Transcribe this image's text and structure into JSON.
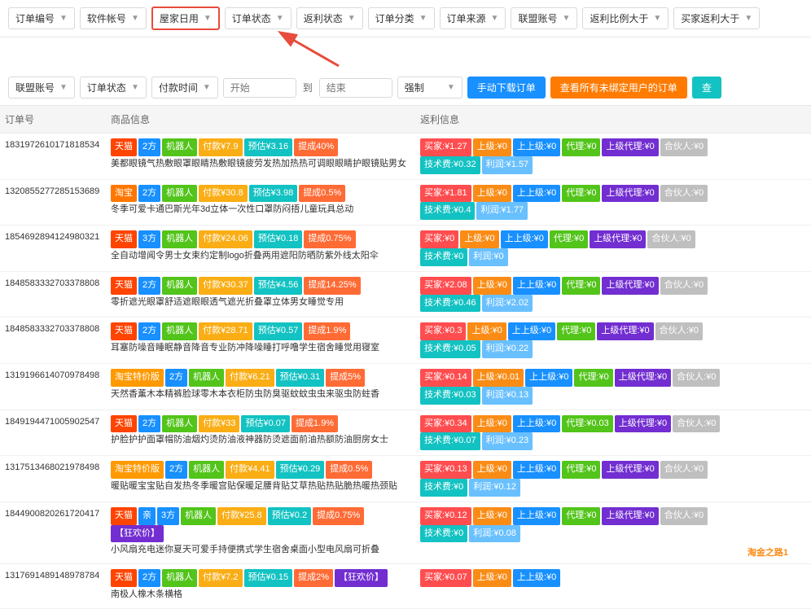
{
  "filters_top": {
    "order_no": {
      "label": "订单编号",
      "placeholder": ""
    },
    "software_account": {
      "label": "软件帐号"
    },
    "category": {
      "label": "屋家日用",
      "highlighted": true
    },
    "order_status": {
      "label": "订单状态"
    },
    "rebate_status": {
      "label": "返利状态"
    },
    "order_type": {
      "label": "订单分类"
    },
    "order_source": {
      "label": "订单来源"
    },
    "union_account": {
      "label": "联盟账号"
    },
    "rebate_ratio": {
      "label": "返利比例大于"
    },
    "buyer_rebate": {
      "label": "买家返利大于"
    }
  },
  "filters_bottom": {
    "union_account": {
      "label": "联盟账号"
    },
    "order_status": {
      "label": "订单状态"
    },
    "pay_time": {
      "label": "付款时间"
    },
    "time_start": "开始",
    "time_to": "到",
    "time_end": "结束",
    "force": {
      "label": "强制"
    },
    "btn_download": "手动下载订单",
    "btn_unbound": "查看所有未绑定用户的订单",
    "btn_search": "查"
  },
  "table": {
    "headers": [
      "订单号",
      "商品信息",
      "返利信息"
    ],
    "rows": [
      {
        "order_no": "1831972610171818534",
        "shop_type": "天猫",
        "num": "2方",
        "robot": "机器人",
        "pay": "付款¥7.9",
        "estimate": "预估¥3.16",
        "grow": "提成40%",
        "goods_desc": "美都眼镜气热敷眼罩眼睛热敷眼镜疲劳发热加热热可调眼眼睛护眼镜贴男女",
        "rebate_buyer": "买家:¥1.27",
        "rebate_up": "上级:¥0",
        "rebate_up2": "上上级:¥0",
        "rebate_agent": "代理:¥0",
        "rebate_up_agent": "上级代理:¥0",
        "rebate_partner": "合伙人:¥0",
        "rebate_tech": "技术费:¥0.32",
        "rebate_profit": "利润:¥1.57"
      },
      {
        "order_no": "1320855277285153689",
        "shop_type": "淘宝",
        "num": "2方",
        "robot": "机器人",
        "pay": "付款¥30.8",
        "estimate": "预估¥3.98",
        "grow": "提成0.5%",
        "goods_desc": "冬季可爱卡通巴斯光年3d立体一次性口罩防闷捂儿童玩具总动",
        "rebate_buyer": "买家:¥1.81",
        "rebate_up": "上级:¥0",
        "rebate_up2": "上上级:¥0",
        "rebate_agent": "代理:¥0",
        "rebate_up_agent": "上级代理:¥0",
        "rebate_partner": "合伙人:¥0",
        "rebate_tech": "技术费:¥0.4",
        "rebate_profit": "利润:¥1.77"
      },
      {
        "order_no": "1854692894124980321",
        "shop_type": "天猫",
        "num": "3方",
        "robot": "机器人",
        "pay": "付款¥24.06",
        "estimate": "预估¥0.18",
        "grow": "提成0.75%",
        "goods_desc": "全自动增闻令男士女束约定制logo折叠两用遮阳防晒防紫外线太阳伞",
        "rebate_buyer": "买家:¥0",
        "rebate_up": "上级:¥0",
        "rebate_up2": "上上级:¥0",
        "rebate_agent": "代理:¥0",
        "rebate_up_agent": "上级代理:¥0",
        "rebate_partner": "合伙人:¥0",
        "rebate_tech": "技术费:¥0",
        "rebate_profit": "利润:¥0"
      },
      {
        "order_no": "1848583332703378808",
        "shop_type": "天猫",
        "num": "2方",
        "robot": "机器人",
        "pay": "付款¥30.37",
        "estimate": "预估¥4.56",
        "grow": "提成14.25%",
        "goods_desc": "零折遮光眼罩舒适遮眼眼透气遮光折叠罩立体男女睡觉专用",
        "rebate_buyer": "买家:¥2.08",
        "rebate_up": "上级:¥0",
        "rebate_up2": "上上级:¥0",
        "rebate_agent": "代理:¥0",
        "rebate_up_agent": "上级代理:¥0",
        "rebate_partner": "合伙人:¥0",
        "rebate_tech": "技术费:¥0.46",
        "rebate_profit": "利润:¥2.02"
      },
      {
        "order_no": "1848583332703378808",
        "shop_type": "天猫",
        "num": "2方",
        "robot": "机器人",
        "pay": "付款¥28.71",
        "estimate": "预估¥0.57",
        "grow": "提成1.9%",
        "goods_desc": "耳塞防噪音睡眠静音降音专业防冲降噪睡打呼噜学生宿舍睡觉用寝室",
        "rebate_buyer": "买家:¥0.3",
        "rebate_up": "上级:¥0",
        "rebate_up2": "上上级:¥0",
        "rebate_agent": "代理:¥0",
        "rebate_up_agent": "上级代理:¥0",
        "rebate_partner": "合伙人:¥0",
        "rebate_tech": "技术费:¥0.05",
        "rebate_profit": "利润:¥0.22"
      },
      {
        "order_no": "1319196614070978498",
        "shop_type": "淘宝特价版",
        "num": "2方",
        "robot": "机器人",
        "pay": "付款¥6.21",
        "estimate": "预估¥0.31",
        "grow": "提成5%",
        "goods_desc": "天然香薰木本精裤脸球零木本衣柜防虫防臭驱蚊蚊虫虫来驱虫防蛀香",
        "rebate_buyer": "买家:¥0.14",
        "rebate_up": "上级:¥0.01",
        "rebate_up2": "上上级:¥0",
        "rebate_agent": "代理:¥0",
        "rebate_up_agent": "上级代理:¥0",
        "rebate_partner": "合伙人:¥0",
        "rebate_tech": "技术费:¥0.03",
        "rebate_profit": "利润:¥0.13"
      },
      {
        "order_no": "1849194471005902547",
        "shop_type": "天猫",
        "num": "2方",
        "robot": "机器人",
        "pay": "付款¥33",
        "estimate": "预估¥0.07",
        "grow": "提成1.9%",
        "goods_desc": "护脸护护面罩帽防油烟灼烫防油液神器防烫遮面前油热额防油厨房女士",
        "rebate_buyer": "买家:¥0.34",
        "rebate_up": "上级:¥0",
        "rebate_up2": "上上级:¥0",
        "rebate_agent": "代理:¥0.03",
        "rebate_up_agent": "上级代理:¥0",
        "rebate_partner": "合伙人:¥0",
        "rebate_tech": "技术费:¥0.07",
        "rebate_profit": "利润:¥0.23"
      },
      {
        "order_no": "1317513468021978498",
        "shop_type": "淘宝特价版",
        "num": "2方",
        "robot": "机器人",
        "pay": "付款¥4.41",
        "estimate": "预估¥0.29",
        "grow": "提成0.5%",
        "goods_desc": "暖贴暖宝宝贴自发热冬季暖宫贴保暖足腰背贴艾草热贴热贴脆热暖热颈贴",
        "rebate_buyer": "买家:¥0.13",
        "rebate_up": "上级:¥0",
        "rebate_up2": "上上级:¥0",
        "rebate_agent": "代理:¥0",
        "rebate_up_agent": "上级代理:¥0",
        "rebate_partner": "合伙人:¥0",
        "rebate_tech": "技术费:¥0",
        "rebate_profit": "利润:¥0.12"
      },
      {
        "order_no": "1844900820261720417",
        "shop_type": "天猫",
        "special": "亲",
        "num": "3方",
        "robot": "机器人",
        "pay": "付款¥25.8",
        "estimate": "预估¥0.2",
        "grow": "提成0.75%",
        "tag_special": "狂欢价",
        "goods_desc": "小风扇充电迷你夏天可爱手持便携式学生宿舍桌面小型电风扇可折叠",
        "rebate_buyer": "买家:¥0.12",
        "rebate_up": "上级:¥0",
        "rebate_up2": "上上级:¥0",
        "rebate_agent": "代理:¥0",
        "rebate_up_agent": "上级代理:¥0",
        "rebate_partner": "合伙人:¥0",
        "rebate_tech": "技术费:¥0",
        "rebate_profit": "利润:¥0.08"
      },
      {
        "order_no": "1317691489148978784",
        "shop_type": "天猫",
        "num": "2方",
        "robot": "机器人",
        "pay": "付款¥7.2",
        "estimate": "预估¥0.15",
        "grow": "提成2%",
        "tag_special": "狂欢价",
        "goods_desc": "南极人橡木条横格",
        "rebate_buyer": "买家:¥0.07",
        "rebate_up": "上级:¥0",
        "rebate_up2": "上上级:¥0"
      }
    ]
  },
  "watermark": "淘金之路1"
}
